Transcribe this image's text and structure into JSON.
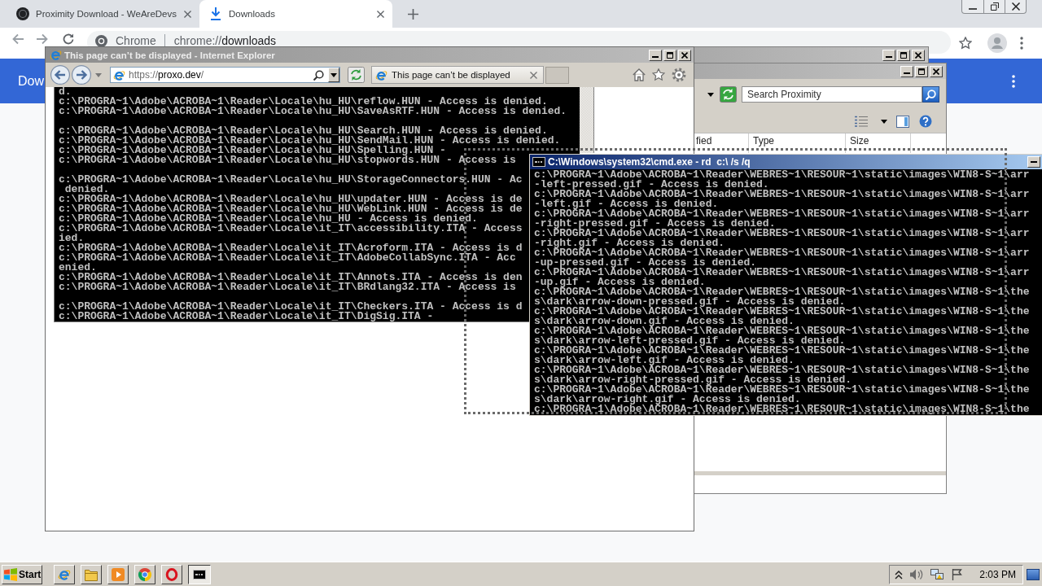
{
  "chrome": {
    "tabs": [
      {
        "kind": "site",
        "title": "Proximity Download - WeAreDevs",
        "selected": false
      },
      {
        "kind": "downloads",
        "title": "Downloads",
        "selected": true
      }
    ],
    "omnibox": {
      "chip": "Chrome",
      "url_parts": [
        {
          "text": "chrome://",
          "emphasized": false
        },
        {
          "text": "downloads",
          "emphasized": true
        }
      ]
    },
    "page": {
      "title": "Dow"
    }
  },
  "explorer": {
    "search": {
      "placeholder": "Search Proximity"
    },
    "columns": [
      "fied",
      "Type",
      "Size"
    ]
  },
  "ie_window": {
    "title": "This page can’t be displayed - Internet Explorer",
    "address_parts": [
      {
        "text": "https://",
        "emphasized": false
      },
      {
        "text": "proxo.dev",
        "emphasized": true
      },
      {
        "text": "/",
        "emphasized": false
      }
    ],
    "tab_title": "This page can’t be displayed",
    "console_blocks": [
      [
        "d.",
        "c:\\PROGRA~1\\Adobe\\ACROBA~1\\Reader\\Locale\\hu_HU\\reflow.HUN - Access is denied.",
        "c:\\PROGRA~1\\Adobe\\ACROBA~1\\Reader\\Locale\\hu_HU\\SaveAsRTF.HUN - Access is denied."
      ],
      [
        "c:\\PROGRA~1\\Adobe\\ACROBA~1\\Reader\\Locale\\hu_HU\\Search.HUN - Access is denied.",
        "c:\\PROGRA~1\\Adobe\\ACROBA~1\\Reader\\Locale\\hu_HU\\SendMail.HUN - Access is denied.",
        "c:\\PROGRA~1\\Adobe\\ACROBA~1\\Reader\\Locale\\hu_HU\\Spelling.HUN -",
        "c:\\PROGRA~1\\Adobe\\ACROBA~1\\Reader\\Locale\\hu_HU\\stopwords.HUN - Access is"
      ],
      [
        "c:\\PROGRA~1\\Adobe\\ACROBA~1\\Reader\\Locale\\hu_HU\\StorageConnectors.HUN - Ac",
        " denied.",
        "c:\\PROGRA~1\\Adobe\\ACROBA~1\\Reader\\Locale\\hu_HU\\updater.HUN - Access is de",
        "c:\\PROGRA~1\\Adobe\\ACROBA~1\\Reader\\Locale\\hu_HU\\WebLink.HUN - Access is de",
        "c:\\PROGRA~1\\Adobe\\ACROBA~1\\Reader\\Locale\\hu_HU - Access is denied.",
        "c:\\PROGRA~1\\Adobe\\ACROBA~1\\Reader\\Locale\\it_IT\\accessibility.ITA - Access",
        "ied.",
        "c:\\PROGRA~1\\Adobe\\ACROBA~1\\Reader\\Locale\\it_IT\\Acroform.ITA - Access is d",
        "c:\\PROGRA~1\\Adobe\\ACROBA~1\\Reader\\Locale\\it_IT\\AdobeCollabSync.ITA - Acc",
        "enied.",
        "c:\\PROGRA~1\\Adobe\\ACROBA~1\\Reader\\Locale\\it_IT\\Annots.ITA - Access is den",
        "c:\\PROGRA~1\\Adobe\\ACROBA~1\\Reader\\Locale\\it_IT\\BRdlang32.ITA - Access is"
      ],
      [
        "c:\\PROGRA~1\\Adobe\\ACROBA~1\\Reader\\Locale\\it_IT\\Checkers.ITA - Access is d",
        "c:\\PROGRA~1\\Adobe\\ACROBA~1\\Reader\\Locale\\it_IT\\DigSig.ITA -"
      ]
    ]
  },
  "cmd_window": {
    "title": "C:\\Windows\\system32\\cmd.exe - rd  c:\\ /s /q",
    "lines": [
      "c:\\PROGRA~1\\Adobe\\ACROBA~1\\Reader\\WEBRES~1\\RESOUR~1\\static\\images\\WIN8-S~1\\arr",
      "-left-pressed.gif - Access is denied.",
      "c:\\PROGRA~1\\Adobe\\ACROBA~1\\Reader\\WEBRES~1\\RESOUR~1\\static\\images\\WIN8-S~1\\arr",
      "-left.gif - Access is denied.",
      "c:\\PROGRA~1\\Adobe\\ACROBA~1\\Reader\\WEBRES~1\\RESOUR~1\\static\\images\\WIN8-S~1\\arr",
      "-right-pressed.gif - Access is denied.",
      "c:\\PROGRA~1\\Adobe\\ACROBA~1\\Reader\\WEBRES~1\\RESOUR~1\\static\\images\\WIN8-S~1\\arr",
      "-right.gif - Access is denied.",
      "c:\\PROGRA~1\\Adobe\\ACROBA~1\\Reader\\WEBRES~1\\RESOUR~1\\static\\images\\WIN8-S~1\\arr",
      "-up-pressed.gif - Access is denied.",
      "c:\\PROGRA~1\\Adobe\\ACROBA~1\\Reader\\WEBRES~1\\RESOUR~1\\static\\images\\WIN8-S~1\\arr",
      "-up.gif - Access is denied.",
      "c:\\PROGRA~1\\Adobe\\ACROBA~1\\Reader\\WEBRES~1\\RESOUR~1\\static\\images\\WIN8-S~1\\the",
      "s\\dark\\arrow-down-pressed.gif - Access is denied.",
      "c:\\PROGRA~1\\Adobe\\ACROBA~1\\Reader\\WEBRES~1\\RESOUR~1\\static\\images\\WIN8-S~1\\the",
      "s\\dark\\arrow-down.gif - Access is denied.",
      "c:\\PROGRA~1\\Adobe\\ACROBA~1\\Reader\\WEBRES~1\\RESOUR~1\\static\\images\\WIN8-S~1\\the",
      "s\\dark\\arrow-left-pressed.gif - Access is denied.",
      "c:\\PROGRA~1\\Adobe\\ACROBA~1\\Reader\\WEBRES~1\\RESOUR~1\\static\\images\\WIN8-S~1\\the",
      "s\\dark\\arrow-left.gif - Access is denied.",
      "c:\\PROGRA~1\\Adobe\\ACROBA~1\\Reader\\WEBRES~1\\RESOUR~1\\static\\images\\WIN8-S~1\\the",
      "s\\dark\\arrow-right-pressed.gif - Access is denied.",
      "c:\\PROGRA~1\\Adobe\\ACROBA~1\\Reader\\WEBRES~1\\RESOUR~1\\static\\images\\WIN8-S~1\\the",
      "s\\dark\\arrow-right.gif - Access is denied.",
      "c:\\PROGRA~1\\Adobe\\ACROBA~1\\Reader\\WEBRES~1\\RESOUR~1\\static\\images\\WIN8-S~1\\the"
    ]
  },
  "taskbar": {
    "start": "Start",
    "apps": [
      {
        "kind": "ie",
        "selected": false
      },
      {
        "kind": "folder",
        "selected": false
      },
      {
        "kind": "media",
        "selected": false
      },
      {
        "kind": "chrome",
        "selected": false
      },
      {
        "kind": "opera",
        "selected": false
      },
      {
        "kind": "console",
        "selected": true
      }
    ],
    "clock": "2:03 PM"
  }
}
